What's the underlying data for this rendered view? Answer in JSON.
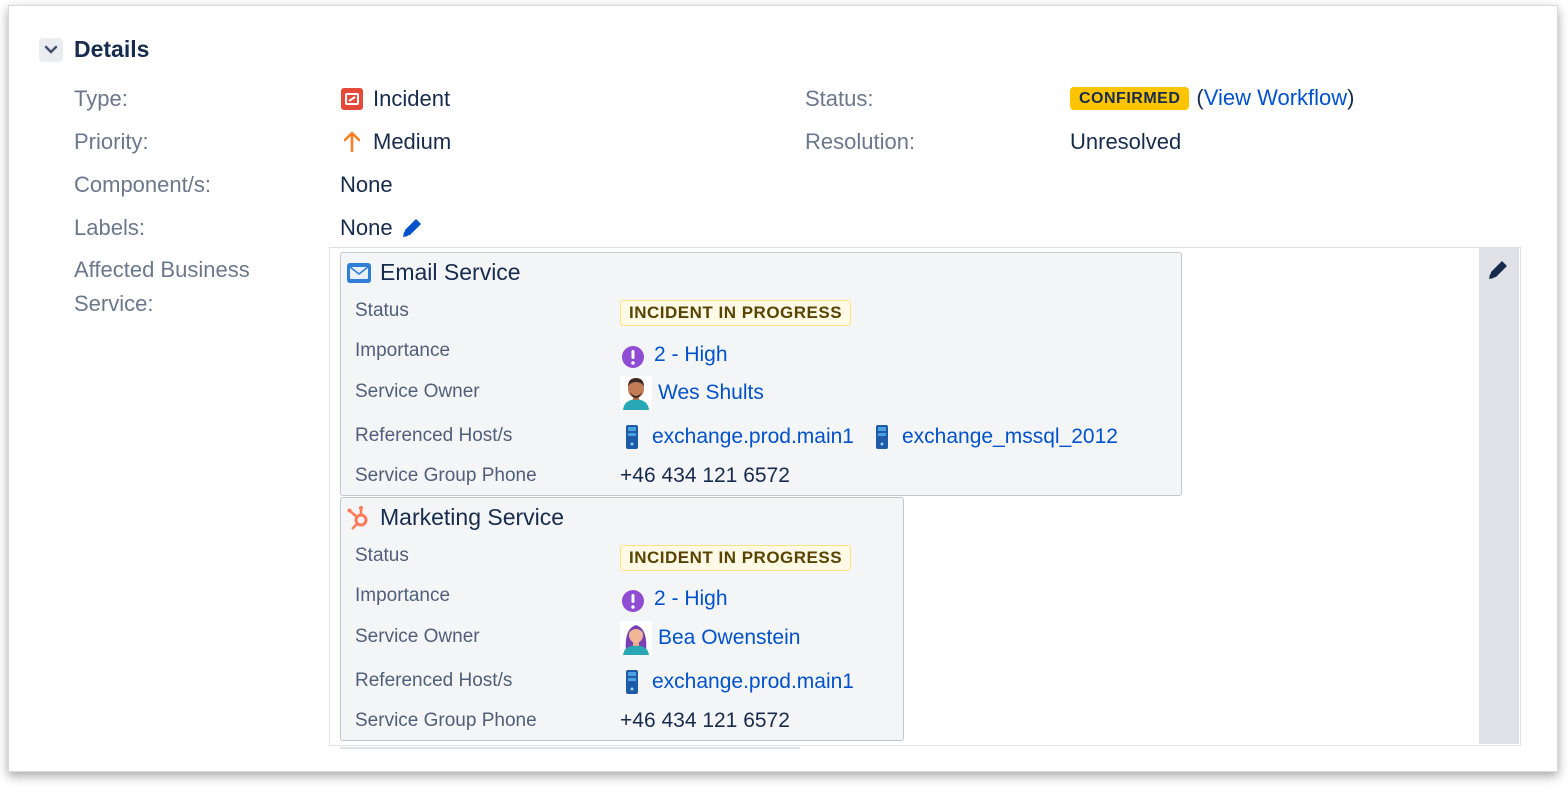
{
  "section": {
    "title": "Details"
  },
  "fields": {
    "type": {
      "label": "Type:",
      "value": "Incident"
    },
    "priority": {
      "label": "Priority:",
      "value": "Medium"
    },
    "components": {
      "label": "Component/s:",
      "value": "None"
    },
    "labels": {
      "label": "Labels:",
      "value": "None"
    },
    "affected": {
      "label_line1": "Affected Business",
      "label_line2": "Service:"
    },
    "status": {
      "label": "Status:",
      "value": "CONFIRMED",
      "workflow_link": "View Workflow",
      "paren_open": "(",
      "paren_close": ")"
    },
    "resolution": {
      "label": "Resolution:",
      "value": "Unresolved"
    }
  },
  "services": [
    {
      "name": "Email Service",
      "icon": "envelope-icon",
      "status_label": "Status",
      "status_value": "INCIDENT IN PROGRESS",
      "importance_label": "Importance",
      "importance_value": "2 - High",
      "owner_label": "Service Owner",
      "owner_value": "Wes Shults",
      "hosts_label": "Referenced Host/s",
      "hosts": [
        "exchange.prod.main1",
        "exchange_mssql_2012"
      ],
      "phone_label": "Service Group Phone",
      "phone_value": "+46 434 121 6572"
    },
    {
      "name": "Marketing Service",
      "icon": "hubspot-icon",
      "status_label": "Status",
      "status_value": "INCIDENT IN PROGRESS",
      "importance_label": "Importance",
      "importance_value": "2 - High",
      "owner_label": "Service Owner",
      "owner_value": "Bea Owenstein",
      "hosts_label": "Referenced Host/s",
      "hosts": [
        "exchange.prod.main1"
      ],
      "phone_label": "Service Group Phone",
      "phone_value": "+46 434 121 6572"
    }
  ],
  "colors": {
    "link": "#0052cc",
    "confirmed": "#ffc400",
    "incident_red": "#e5493a",
    "priority_orange": "#ff7e21",
    "importance_purple": "#8e4dd2"
  }
}
